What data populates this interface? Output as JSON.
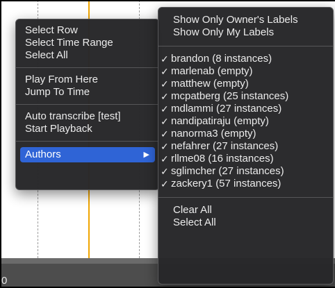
{
  "main_menu": {
    "groups": [
      [
        "Select Row",
        "Select Time Range",
        "Select All"
      ],
      [
        "Play From Here",
        "Jump To Time"
      ],
      [
        "Auto transcribe [test]",
        "Start Playback"
      ]
    ],
    "authors_label": "Authors",
    "submenu_arrow": "▶"
  },
  "authors_submenu": {
    "top_items": [
      "Show Only Owner's Labels",
      "Show Only My Labels"
    ],
    "check_glyph": "✓",
    "authors": [
      "brandon (8 instances)",
      "marlenab (empty)",
      "matthew (empty)",
      "mcpatberg (25 instances)",
      "mdlammi (27 instances)",
      "nandipatiraju (empty)",
      "nanorma3 (empty)",
      "nefahrer (27 instances)",
      "rllme08 (16 instances)",
      "sglimcher (27 instances)",
      "zackery1 (57 instances)"
    ],
    "bottom_items": [
      "Clear All",
      "Select All"
    ]
  },
  "background": {
    "corner_text": "0",
    "playhead_color": "#f0a500",
    "highlight_color": "#2f64d6"
  }
}
